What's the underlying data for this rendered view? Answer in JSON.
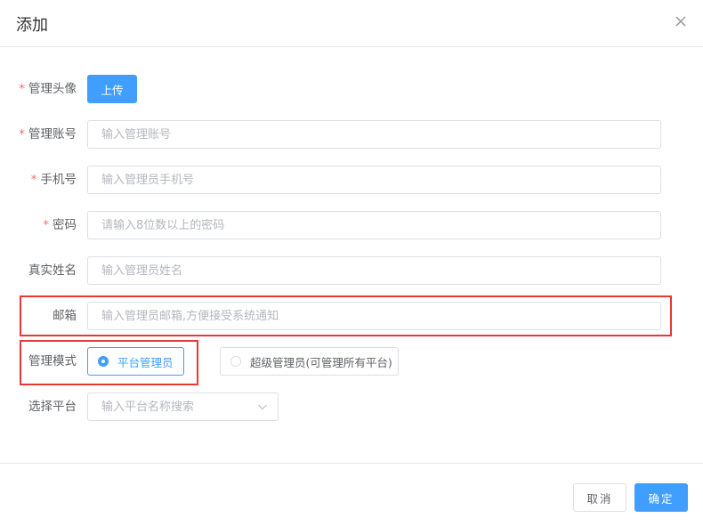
{
  "dialog": {
    "title": "添加",
    "close_icon": "close-icon"
  },
  "form": {
    "avatar": {
      "label": "管理头像",
      "required": "*",
      "button": "上传"
    },
    "account": {
      "label": "管理账号",
      "required": "*",
      "placeholder": "输入管理账号",
      "value": ""
    },
    "phone": {
      "label": "手机号",
      "required": "*",
      "placeholder": "输入管理员手机号",
      "value": ""
    },
    "password": {
      "label": "密码",
      "required": "*",
      "placeholder": "请输入8位数以上的密码",
      "value": ""
    },
    "realname": {
      "label": "真实姓名",
      "placeholder": "输入管理员姓名",
      "value": ""
    },
    "email": {
      "label": "邮箱",
      "placeholder": "输入管理员邮箱,方便接受系统通知",
      "value": ""
    },
    "mode": {
      "label": "管理模式",
      "options": [
        {
          "label": "平台管理员",
          "checked": true
        },
        {
          "label": "超级管理员(可管理所有平台)",
          "checked": false
        }
      ]
    },
    "platform": {
      "label": "选择平台",
      "placeholder": "输入平台名称搜索",
      "icon": "chevron-down-icon"
    }
  },
  "footer": {
    "cancel": "取消",
    "confirm": "确定"
  },
  "colors": {
    "primary": "#409eff",
    "required": "#f56c6c",
    "highlight": "#e53935",
    "border": "#dcdfe6"
  }
}
